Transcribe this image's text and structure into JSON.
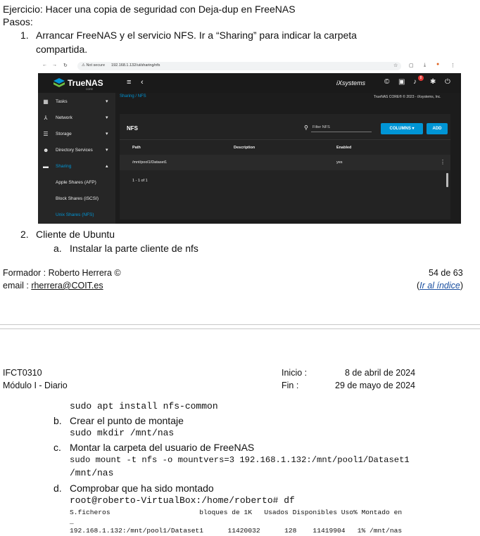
{
  "document": {
    "title": "Ejercicio: Hacer una copia de seguridad con Deja-dup en FreeNAS",
    "steps_label": "Pasos:",
    "step1_num": "1.",
    "step1_line1": "Arrancar FreeNAS y el servicio NFS. Ir a “Sharing” para indicar la carpeta",
    "step1_line2": "compartida.",
    "step2_num": "2.",
    "step2_text": "Cliente de Ubuntu",
    "step2a_letter": "a.",
    "step2a_text": "Instalar la parte cliente de nfs"
  },
  "footer": {
    "formador": "Formador : Roberto Herrera ©",
    "email_label": "email :",
    "email": "rherrera@COIT.es",
    "page": "54 de 63",
    "index_open": "(",
    "index_link": "Ir al índice",
    "index_close": ")"
  },
  "header2": {
    "code": "IFCT0310",
    "module": "Módulo I - Diario",
    "inicio_label": "Inicio :",
    "inicio_value": "8 de abril de 2024",
    "fin_label": "Fin :",
    "fin_value": "29 de mayo de 2024"
  },
  "continuation": {
    "cmd_install": "sudo apt install nfs-common",
    "b_letter": "b.",
    "b_text": "Crear el punto de montaje",
    "cmd_mkdir": "sudo mkdir /mnt/nas",
    "c_letter": "c.",
    "c_text": "Montar la carpeta del usuario de FreeNAS",
    "cmd_mount1": "sudo mount -t nfs -o mountvers=3 192.168.1.132:/mnt/pool1/Dataset1",
    "cmd_mount2": "/mnt/nas",
    "d_letter": "d.",
    "d_text": "Comprobar que ha sido montado",
    "cmd_df": "root@roberto-VirtualBox:/home/roberto# df",
    "df_header": "S.ficheros                      bloques de 1K   Usados Disponibles Uso% Montado en",
    "df_ellipsis": "…",
    "df_row": "192.168.1.132:/mnt/pool1/Dataset1      11420032      128    11419904   1% /mnt/nas"
  },
  "screenshot": {
    "browser": {
      "not_secure": "⚠ Not secure",
      "url": "192.168.1.132/ui/sharing/nfs"
    },
    "brand": "TrueNAS",
    "brand_sub": "CORE",
    "ix_logo": "iXsystems",
    "notification_count": "8",
    "breadcrumb": "Sharing / NFS",
    "copyright": "TrueNAS CORE® © 2023 - iXsystems, Inc.",
    "sidebar": [
      {
        "label": "Tasks",
        "icon": "calendar-icon"
      },
      {
        "label": "Network",
        "icon": "network-icon"
      },
      {
        "label": "Storage",
        "icon": "storage-icon"
      },
      {
        "label": "Directory Services",
        "icon": "directory-icon"
      },
      {
        "label": "Sharing",
        "icon": "folder-icon"
      }
    ],
    "submenu": [
      "Apple Shares (AFP)",
      "Block Shares (iSCSI)",
      "Unix Shares (NFS)"
    ],
    "panel_title": "NFS",
    "filter_placeholder": "Filter NFS",
    "columns_button": "COLUMNS",
    "add_button": "ADD",
    "table_headers": [
      "Path",
      "Description",
      "Enabled"
    ],
    "row": {
      "path": "/mnt/pool1/Dataset1",
      "description": "",
      "enabled": "yes"
    },
    "pager": "1 - 1 of 1"
  }
}
